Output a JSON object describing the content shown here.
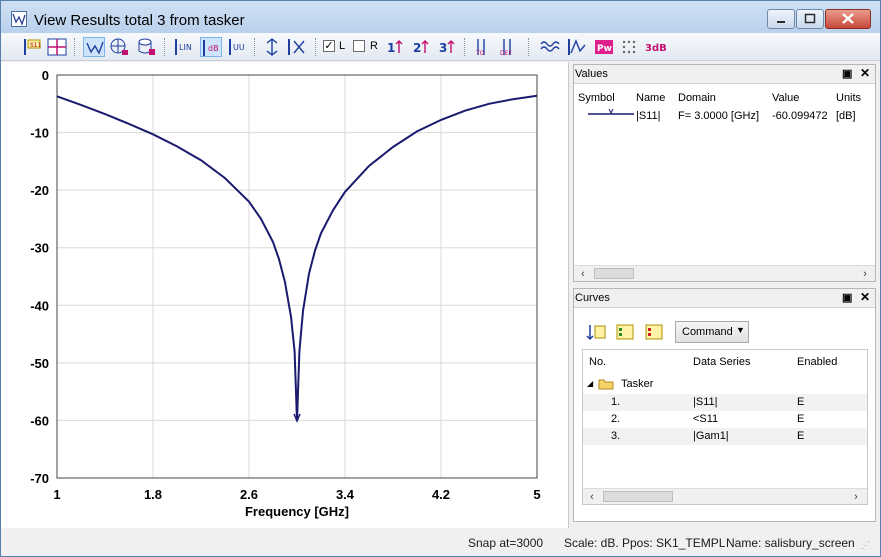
{
  "window": {
    "title": "View Results total 3 from tasker"
  },
  "toolbar": {
    "check_left_label": "L",
    "check_right_label": "R",
    "check_left_mark": "✓",
    "icons": [
      "s11-marker-icon",
      "crosshair-icon",
      "smith-chart-icon",
      "polar-chart-icon",
      "database-icon",
      "linear-scale-icon",
      "db-scale-icon",
      "unit-scale-icon",
      "autoscale-icon",
      "zoom-fit-icon",
      "marker-1-icon",
      "marker-2-icon",
      "marker-3-icon",
      "marker-to-icon",
      "marker-def-icon",
      "waveform-icon",
      "peak-icon",
      "power-icon",
      "grid-points-icon",
      "3db-icon"
    ]
  },
  "chart_data": {
    "type": "line",
    "title": "",
    "xlabel": "Frequency [GHz]",
    "ylabel": "",
    "xlim": [
      1,
      5
    ],
    "ylim": [
      -70,
      0
    ],
    "x_ticks": [
      "1",
      "1.8",
      "2.6",
      "3.4",
      "4.2",
      "5"
    ],
    "y_ticks": [
      "0",
      "-10",
      "-20",
      "-30",
      "-40",
      "-50",
      "-60",
      "-70"
    ],
    "grid": true,
    "series": [
      {
        "color": "#1a1a6e",
        "x": [
          1.0,
          1.2,
          1.4,
          1.6,
          1.8,
          2.0,
          2.2,
          2.4,
          2.6,
          2.7,
          2.8,
          2.85,
          2.9,
          2.95,
          2.98,
          3.0,
          3.02,
          3.05,
          3.1,
          3.15,
          3.2,
          3.3,
          3.4,
          3.6,
          3.8,
          4.0,
          4.2,
          4.4,
          4.6,
          4.8,
          5.0
        ],
        "values": [
          -3.7,
          -5.2,
          -6.8,
          -8.5,
          -10.3,
          -12.4,
          -14.8,
          -17.9,
          -22.0,
          -25.0,
          -29.0,
          -32.0,
          -36.0,
          -42.0,
          -48.0,
          -60.1,
          -48.0,
          -41.0,
          -34.5,
          -30.5,
          -27.5,
          -23.5,
          -20.3,
          -15.8,
          -12.5,
          -9.8,
          -7.8,
          -6.2,
          -5.0,
          -4.2,
          -3.6
        ]
      }
    ]
  },
  "values_panel": {
    "title": "Values",
    "columns": [
      "Symbol",
      "Name",
      "Domain",
      "Value",
      "Units"
    ],
    "rows": [
      {
        "name": "|S11|",
        "domain": "F= 3.0000 [GHz]",
        "value": "-60.099472",
        "units": "[dB]"
      }
    ]
  },
  "curves_panel": {
    "title": "Curves",
    "command_label": "Command",
    "columns": [
      "No.",
      "Data Series",
      "Enabled"
    ],
    "group": "Tasker",
    "rows": [
      {
        "no": "1.",
        "series": "|S11|",
        "enabled": "E"
      },
      {
        "no": "2.",
        "series": "<S11",
        "enabled": "E"
      },
      {
        "no": "3.",
        "series": "|Gam1|",
        "enabled": "E"
      }
    ]
  },
  "statusbar": {
    "snap": "Snap at=3000",
    "scale": "Scale: dB.",
    "ppos": "Ppos: SK1_TEMPL",
    "name": "Name: salisbury_screen"
  }
}
